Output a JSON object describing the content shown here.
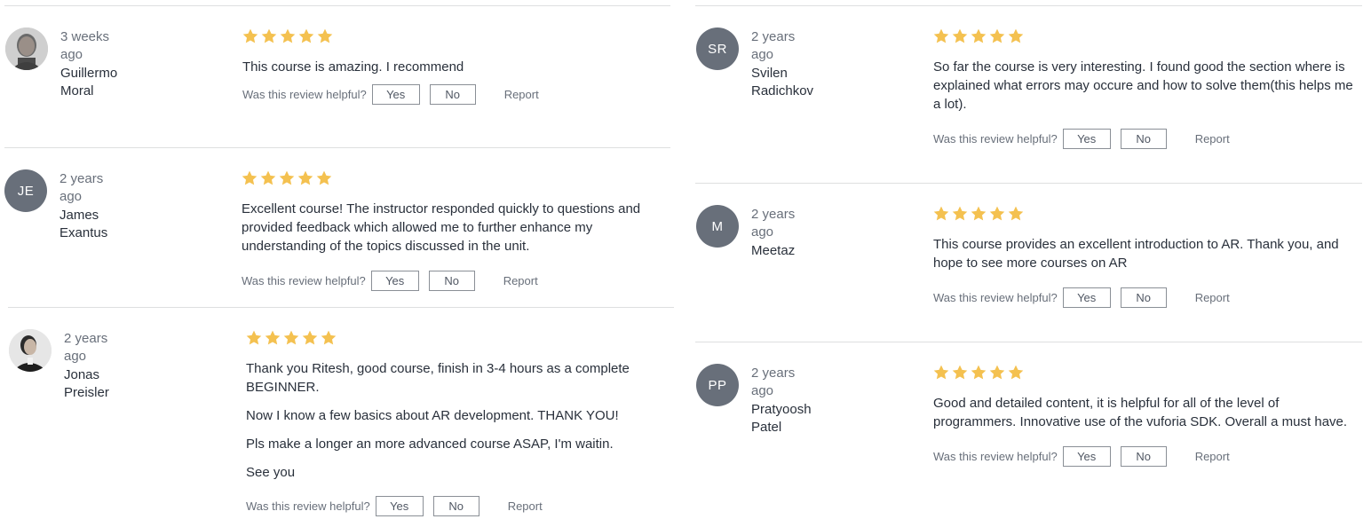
{
  "colors": {
    "star": "#f4c150",
    "avatar_bg": "#686f7a",
    "divider": "#dedfe0"
  },
  "helpful_label": "Was this review helpful?",
  "yes_label": "Yes",
  "no_label": "No",
  "report_label": "Report",
  "reviews": [
    {
      "time": "3 weeks ago",
      "name": "Guillermo Moral",
      "avatar": "photo",
      "rating": 5,
      "paragraphs": [
        "This course is amazing. I recommend"
      ]
    },
    {
      "time": "2 years ago",
      "name": "James Exantus",
      "initials": "JE",
      "rating": 5,
      "paragraphs": [
        "Excellent course! The instructor responded quickly to questions and provided feedback which allowed me to further enhance my understanding of the topics discussed in the unit."
      ]
    },
    {
      "time": "2 years ago",
      "name": "Jonas Preisler",
      "avatar": "photo",
      "rating": 5,
      "paragraphs": [
        "Thank you Ritesh, good course, finish in 3-4 hours as a complete BEGINNER.",
        "Now I know a few basics about AR development. THANK YOU!",
        "Pls make a longer an more advanced course ASAP, I'm waitin.",
        "See you"
      ]
    },
    {
      "time": "2 years ago",
      "name": "Svilen Radichkov",
      "initials": "SR",
      "rating": 5,
      "paragraphs": [
        "So far the course is very interesting. I found good the section where is explained what errors may occure and how to solve them(this helps me a lot)."
      ]
    },
    {
      "time": "2 years ago",
      "name": "Meetaz",
      "initials": "M",
      "rating": 5,
      "paragraphs": [
        "This course provides an excellent introduction to AR. Thank you, and hope to see more courses on AR"
      ]
    },
    {
      "time": "2 years ago",
      "name": "Pratyoosh Patel",
      "initials": "PP",
      "rating": 5,
      "paragraphs": [
        "Good and detailed content, it is helpful for all of the level of programmers. Innovative use of the vuforia SDK. Overall a must have."
      ]
    }
  ]
}
